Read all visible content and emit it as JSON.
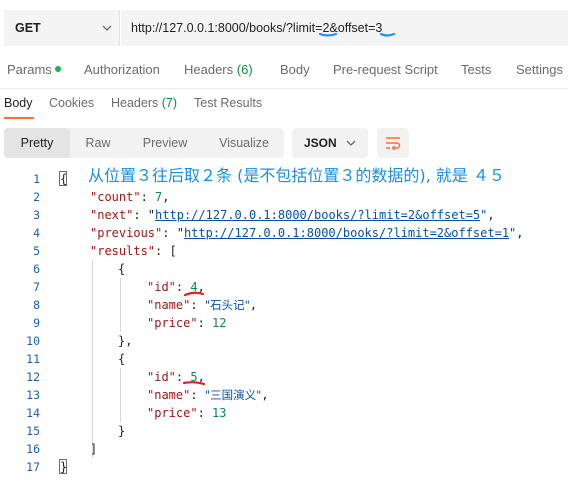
{
  "request": {
    "method": "GET",
    "url_prefix": "http://127.0.0.1:8000/books/?limit=",
    "limit_value": "2",
    "url_middle": "&offset=",
    "offset_value": "3"
  },
  "main_tabs": {
    "params": "Params",
    "authorization": "Authorization",
    "headers": "Headers",
    "headers_count": "(6)",
    "body": "Body",
    "pre_request_script": "Pre-request Script",
    "tests": "Tests",
    "settings": "Settings"
  },
  "response_tabs": {
    "body": "Body",
    "cookies": "Cookies",
    "headers": "Headers",
    "headers_count": "(7)",
    "test_results": "Test Results"
  },
  "toolbar": {
    "pretty": "Pretty",
    "raw": "Raw",
    "preview": "Preview",
    "visualize": "Visualize",
    "format": "JSON"
  },
  "annotation": "从位置３往后取２条 (是不包括位置３的数据的), 就是 ４５",
  "code": {
    "line_numbers": [
      "1",
      "2",
      "3",
      "4",
      "5",
      "6",
      "7",
      "8",
      "9",
      "10",
      "11",
      "12",
      "13",
      "14",
      "15",
      "16",
      "17"
    ],
    "count_key": "\"count\"",
    "count_value": "7",
    "next_key": "\"next\"",
    "next_value": "http://127.0.0.1:8000/books/?limit=2&offset=5",
    "previous_key": "\"previous\"",
    "previous_value": "http://127.0.0.1:8000/books/?limit=2&offset=1",
    "results_key": "\"results\"",
    "items": [
      {
        "id_key": "\"id\"",
        "id_value": "4",
        "name_key": "\"name\"",
        "name_value": "\"石头记\"",
        "price_key": "\"price\"",
        "price_value": "12"
      },
      {
        "id_key": "\"id\"",
        "id_value": "5",
        "name_key": "\"name\"",
        "name_value": "\"三国演义\"",
        "price_key": "\"price\"",
        "price_value": "13"
      }
    ]
  },
  "colors": {
    "annotation": "#1a8fe0",
    "highlight_blue": "#1e90ff",
    "highlight_red": "#e02020",
    "accent_orange": "#ff6c37"
  }
}
